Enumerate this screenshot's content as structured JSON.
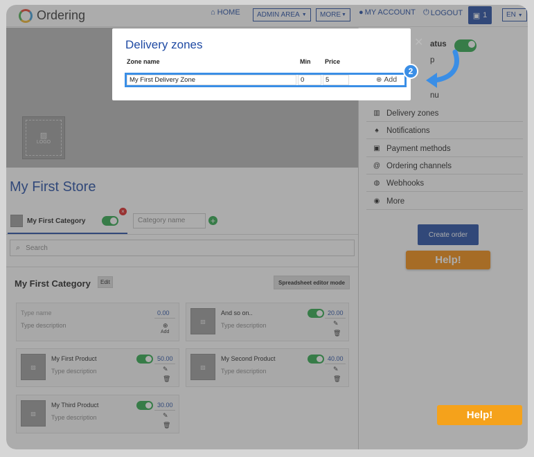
{
  "topbar": {
    "brand": "Ordering",
    "home": "HOME",
    "admin_area": "ADMIN AREA",
    "more": "MORE",
    "my_account": "MY ACCOUNT",
    "logout": "LOGOUT",
    "cart_count": "1",
    "lang": "EN"
  },
  "store": {
    "logo_placeholder": "LOGO",
    "title": "My First Store",
    "category_tab": "My First Category",
    "category_input_placeholder": "Category name",
    "search_placeholder": "Search",
    "category_heading": "My First Category",
    "edit_label": "Edit",
    "spreadsheet_label": "Spreadsheet editor mode"
  },
  "new_product": {
    "name_placeholder": "Type name",
    "desc_placeholder": "Type description",
    "price": "0.00",
    "add_label": "Add"
  },
  "products": [
    {
      "name": "And so on..",
      "desc": "Type description",
      "price": "20.00"
    },
    {
      "name": "My First Product",
      "desc": "Type description",
      "price": "50.00"
    },
    {
      "name": "My Second Product",
      "desc": "Type description",
      "price": "40.00"
    },
    {
      "name": "My Third Product",
      "desc": "Type description",
      "price": "30.00"
    }
  ],
  "sidebar": {
    "status_fragment": "atus",
    "p_fragment": "p",
    "menu_fragment": "nu",
    "items": [
      {
        "label": "Delivery zones",
        "icon": "map-icon"
      },
      {
        "label": "Notifications",
        "icon": "bell-icon"
      },
      {
        "label": "Payment methods",
        "icon": "money-icon"
      },
      {
        "label": "Ordering channels",
        "icon": "at-icon"
      },
      {
        "label": "Webhooks",
        "icon": "globe-icon"
      },
      {
        "label": "More",
        "icon": "circle-icon"
      }
    ],
    "create_order": "Create order",
    "help": "Help!"
  },
  "help_floating": "Help!",
  "modal": {
    "title": "Delivery zones",
    "col_zone": "Zone name",
    "col_min": "Min",
    "col_price": "Price",
    "zone_name": "My First Delivery Zone",
    "min": "0",
    "price": "5",
    "add_label": "Add"
  },
  "step_badge": "2",
  "colors": {
    "accent": "#1f4aa3",
    "highlight": "#3a8ee6",
    "help": "#f58a0b",
    "toggle": "#2aa84a"
  }
}
